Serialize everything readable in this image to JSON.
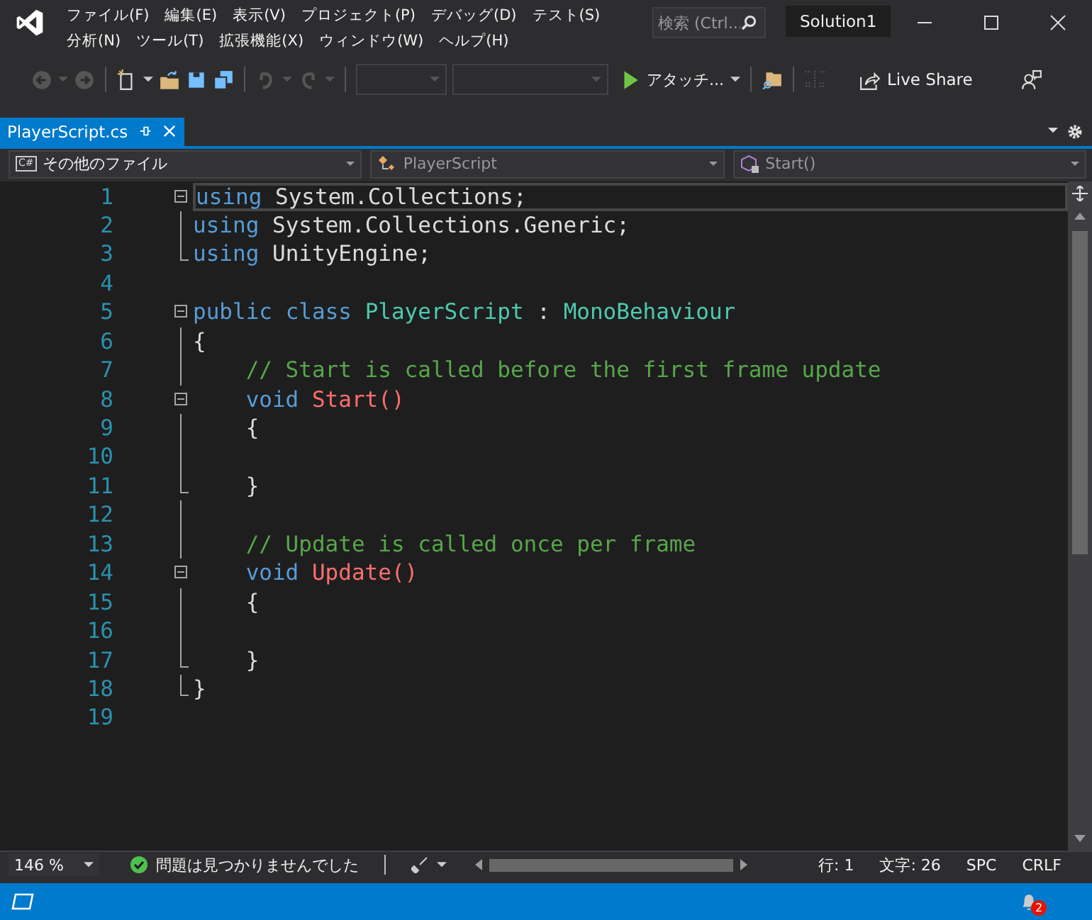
{
  "menu": [
    {
      "label": "ファイル(F)"
    },
    {
      "label": "編集(E)"
    },
    {
      "label": "表示(V)"
    },
    {
      "label": "プロジェクト(P)"
    },
    {
      "label": "デバッグ(D)"
    },
    {
      "label": "テスト(S)"
    },
    {
      "label": "分析(N)"
    },
    {
      "label": "ツール(T)"
    },
    {
      "label": "拡張機能(X)"
    },
    {
      "label": "ウィンドウ(W)"
    },
    {
      "label": "ヘルプ(H)"
    }
  ],
  "search": {
    "placeholder": "検索 (Ctrl..."
  },
  "solution": "Solution1",
  "toolbar": {
    "attach": "アタッチ...",
    "live_share": "Live Share"
  },
  "tab": {
    "label": "PlayerScript.cs",
    "selected": true
  },
  "nav": [
    {
      "kind": "csharp",
      "label": "その他のファイル",
      "icon_text": "C#"
    },
    {
      "kind": "class",
      "label": "PlayerScript"
    },
    {
      "kind": "method",
      "label": "Start()"
    }
  ],
  "code": [
    {
      "number": "1",
      "collapsible": true,
      "outline": false,
      "block_end": false,
      "current": true,
      "indented": false,
      "tokens": [
        {
          "kind": "keyword",
          "text": "using"
        },
        {
          "kind": "plain",
          "text": " System.Collections;"
        }
      ]
    },
    {
      "number": "2",
      "collapsible": false,
      "outline": true,
      "block_end": false,
      "current": false,
      "indented": false,
      "tokens": [
        {
          "kind": "keyword",
          "text": "using"
        },
        {
          "kind": "plain",
          "text": " System.Collections.Generic;"
        }
      ]
    },
    {
      "number": "3",
      "collapsible": false,
      "outline": false,
      "block_end": true,
      "current": false,
      "indented": false,
      "tokens": [
        {
          "kind": "keyword",
          "text": "using"
        },
        {
          "kind": "plain",
          "text": " UnityEngine;"
        }
      ]
    },
    {
      "number": "4",
      "collapsible": false,
      "outline": false,
      "block_end": false,
      "current": false
    },
    {
      "number": "5",
      "collapsible": true,
      "outline": false,
      "block_end": false,
      "current": false,
      "indented": false,
      "tokens": [
        {
          "kind": "keyword",
          "text": "public class"
        },
        {
          "kind": "type",
          "text": " PlayerScript"
        },
        {
          "kind": "plain",
          "text": " : "
        },
        {
          "kind": "type",
          "text": "MonoBehaviour"
        }
      ]
    },
    {
      "number": "6",
      "collapsible": false,
      "outline": true,
      "block_end": false,
      "current": false,
      "indented": false,
      "tokens": [
        {
          "kind": "plain",
          "text": "{"
        }
      ]
    },
    {
      "number": "7",
      "collapsible": false,
      "outline": true,
      "block_end": false,
      "current": false,
      "indented": true,
      "tokens": [
        {
          "kind": "comment",
          "text": "// Start is called before the first frame update"
        }
      ]
    },
    {
      "number": "8",
      "collapsible": true,
      "outline": false,
      "block_end": false,
      "current": false,
      "indented": true,
      "tokens": [
        {
          "kind": "keyword",
          "text": "void"
        },
        {
          "kind": "message",
          "text": " Start()"
        }
      ]
    },
    {
      "number": "9",
      "collapsible": false,
      "outline": true,
      "block_end": false,
      "current": false,
      "indented": true,
      "tokens": [
        {
          "kind": "plain",
          "text": "{"
        }
      ]
    },
    {
      "number": "10",
      "collapsible": false,
      "outline": true,
      "block_end": false,
      "current": false
    },
    {
      "number": "11",
      "collapsible": false,
      "outline": false,
      "block_end": true,
      "current": false,
      "indented": true,
      "tokens": [
        {
          "kind": "plain",
          "text": "}"
        }
      ]
    },
    {
      "number": "12",
      "collapsible": false,
      "outline": true,
      "block_end": false,
      "current": false
    },
    {
      "number": "13",
      "collapsible": false,
      "outline": true,
      "block_end": false,
      "current": false,
      "indented": true,
      "tokens": [
        {
          "kind": "comment",
          "text": "// Update is called once per frame"
        }
      ]
    },
    {
      "number": "14",
      "collapsible": true,
      "outline": false,
      "block_end": false,
      "current": false,
      "indented": true,
      "tokens": [
        {
          "kind": "keyword",
          "text": "void"
        },
        {
          "kind": "message",
          "text": " Update()"
        }
      ]
    },
    {
      "number": "15",
      "collapsible": false,
      "outline": true,
      "block_end": false,
      "current": false,
      "indented": true,
      "tokens": [
        {
          "kind": "plain",
          "text": "{"
        }
      ]
    },
    {
      "number": "16",
      "collapsible": false,
      "outline": true,
      "block_end": false,
      "current": false
    },
    {
      "number": "17",
      "collapsible": false,
      "outline": false,
      "block_end": true,
      "current": false,
      "indented": true,
      "tokens": [
        {
          "kind": "plain",
          "text": "}"
        }
      ]
    },
    {
      "number": "18",
      "collapsible": false,
      "outline": false,
      "block_end": true,
      "current": false,
      "indented": false,
      "tokens": [
        {
          "kind": "plain",
          "text": "}"
        }
      ]
    },
    {
      "number": "19",
      "collapsible": false,
      "outline": false,
      "block_end": false,
      "current": false
    }
  ],
  "status": {
    "zoom": "146 %",
    "issues": "問題は見つかりませんでした",
    "line": "行: 1",
    "char": "文字: 26",
    "spaces": "SPC",
    "eol": "CRLF"
  },
  "notifications": {
    "badge": "2"
  }
}
